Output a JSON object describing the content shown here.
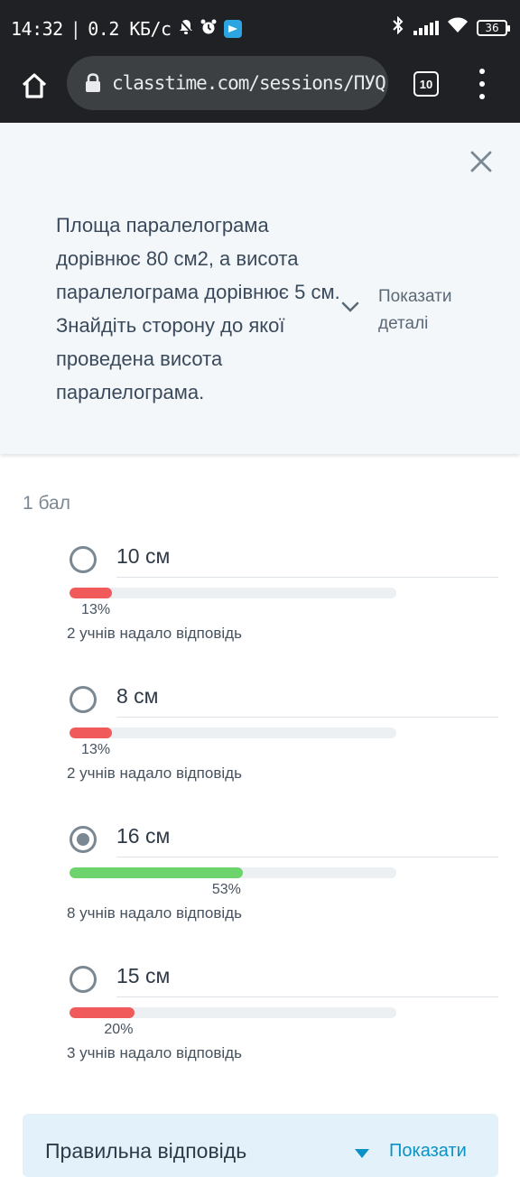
{
  "status_bar": {
    "time": "14:32",
    "separator": "|",
    "speed": "0.2 КБ/с",
    "battery": "36",
    "icons": [
      "bell-off-icon",
      "alarm-icon",
      "telegram-icon",
      "bluetooth-icon",
      "signal-icon",
      "wifi-icon",
      "battery-icon"
    ]
  },
  "browser": {
    "url": "classtime.com/sessions/ПУQ",
    "tab_count": "10",
    "icons": [
      "home-icon",
      "lock-icon",
      "tabs-icon",
      "menu-icon"
    ]
  },
  "question": {
    "text": "Площа паралелограма дорівнює 80 см2, а висота паралелограма дорівнює 5 см. Знайдіть сторону до якої проведена висота паралелограма.",
    "show_details": "Показати деталі"
  },
  "points": "1 бал",
  "options": [
    {
      "label": "10 см",
      "percent": 13,
      "percent_label": "13%",
      "count_text": "2 учнів надало відповідь",
      "selected": false,
      "bar_color": "#f05a5a"
    },
    {
      "label": "8 см",
      "percent": 13,
      "percent_label": "13%",
      "count_text": "2 учнів надало відповідь",
      "selected": false,
      "bar_color": "#f05a5a"
    },
    {
      "label": "16 см",
      "percent": 53,
      "percent_label": "53%",
      "count_text": "8 учнів надало відповідь",
      "selected": true,
      "bar_color": "#6dd46d"
    },
    {
      "label": "15 см",
      "percent": 20,
      "percent_label": "20%",
      "count_text": "3 учнів надало відповідь",
      "selected": false,
      "bar_color": "#f05a5a"
    }
  ],
  "correct_answer": {
    "title": "Правильна відповідь",
    "show": "Показати"
  },
  "colors": {
    "accent": "#0a92c6",
    "wrong": "#f05a5a",
    "correct": "#6dd46d",
    "card_bg": "#f3f7f9"
  }
}
